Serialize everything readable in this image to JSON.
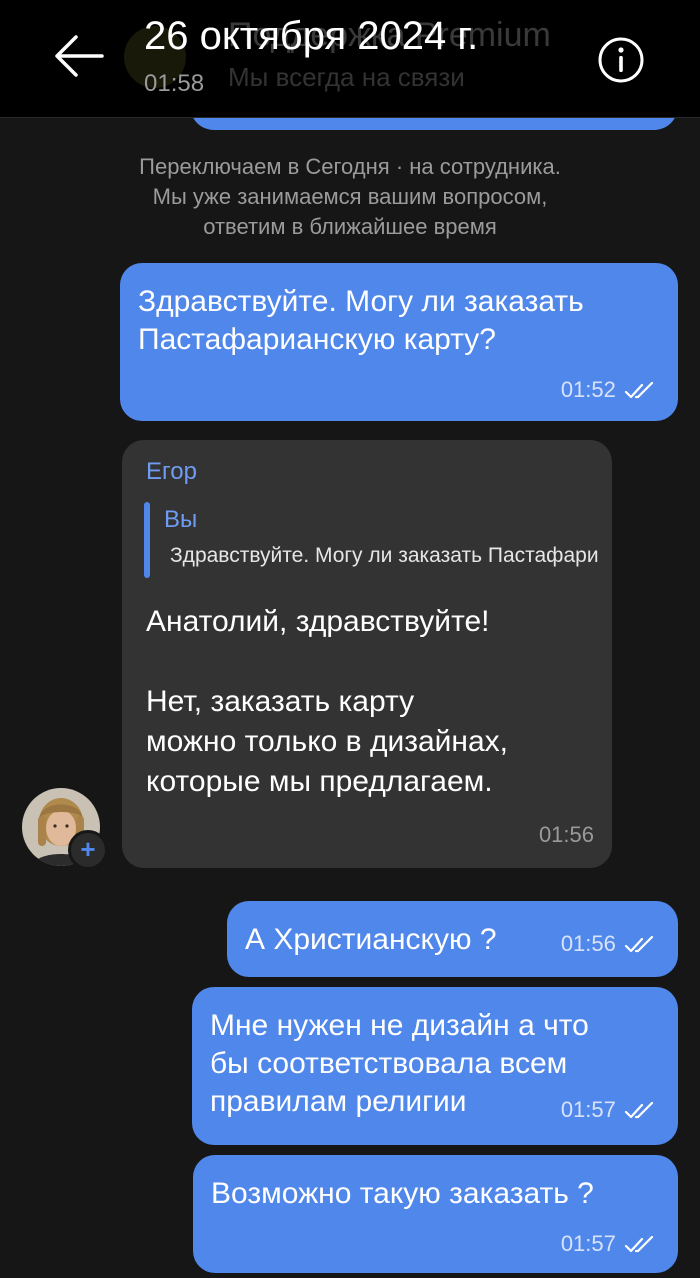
{
  "header": {
    "date_title": "26 октября 2024 г.",
    "date_time": "01:58",
    "contact_name": "Поддержка Premium",
    "contact_status": "Мы всегда на связи"
  },
  "system_note": "Переключаем в  Сегодня  · на сотрудника.\nМы уже занимаемся вашим вопросом,\nответим в ближайшее время",
  "messages": {
    "m1": {
      "text": "Здравствуйте. Могу ли заказать\nПастафарианскую карту?",
      "time": "01:52"
    },
    "incoming": {
      "sender": "Егор",
      "reply_author": "Вы",
      "reply_text": "Здравствуйте. Могу ли заказать Пастафарианскую карту?",
      "text": "Анатолий, здравствуйте!\n\nНет, заказать карту\nможно только в дизайнах,\nкоторые мы предлагаем.",
      "time": "01:56"
    },
    "m2": {
      "text": "А Христианскую ?",
      "time": "01:56"
    },
    "m3": {
      "text": "Мне нужен не дизайн а что\nбы соответствовала всем\nправилам религии",
      "time": "01:57"
    },
    "m4": {
      "text": "Возможно такую заказать ?",
      "time": "01:57"
    }
  },
  "avatar_badge": "+",
  "icons": {
    "back": "arrow-left-icon",
    "info": "info-circle-icon",
    "read": "double-check-icon"
  },
  "colors": {
    "background": "#161616",
    "outgoing_bubble": "#5087ea",
    "incoming_bubble": "#333333",
    "accent": "#6f9cf2"
  }
}
